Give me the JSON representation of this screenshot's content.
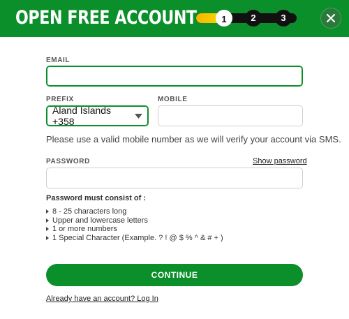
{
  "header": {
    "title": "OPEN FREE ACCOUNT",
    "progress_fraction": 0.25,
    "steps": [
      "1",
      "2",
      "3"
    ],
    "active_step": 1
  },
  "form": {
    "email": {
      "label": "EMAIL",
      "value": "",
      "placeholder": ""
    },
    "prefix": {
      "label": "PREFIX",
      "selected": "Aland Islands +358"
    },
    "mobile": {
      "label": "MOBILE",
      "value": "",
      "placeholder": ""
    },
    "mobile_hint": "Please use a valid mobile number as we will verify your account via SMS.",
    "password": {
      "label": "PASSWORD",
      "value": "",
      "show_link": "Show password"
    },
    "rules_title": "Password must consist of :",
    "rules": [
      "8 - 25 characters long",
      "Upper and lowercase letters",
      "1 or more numbers",
      "1 Special Character (Example. ? ! @ $ % ^ & # + )"
    ],
    "continue_label": "CONTINUE",
    "login_link": "Already have an account? Log In"
  },
  "icons": {
    "close": "close-icon",
    "dropdown": "chevron-down-icon",
    "bullet": "triangle-right-icon"
  },
  "colors": {
    "brand_green": "#0b8f2a",
    "progress_yellow": "#f5c400",
    "step_dark": "#111111"
  }
}
